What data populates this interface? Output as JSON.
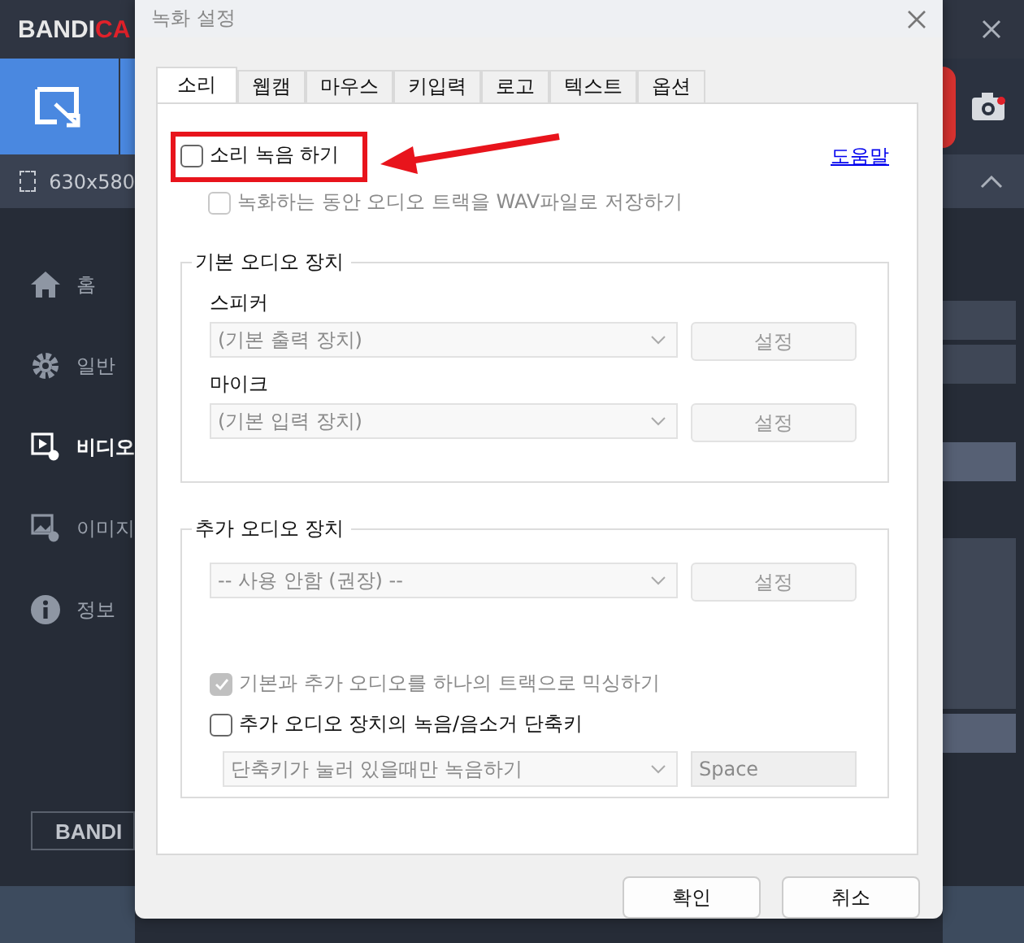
{
  "app": {
    "logo": [
      {
        "text": "BANDI",
        "kind": "plain"
      },
      {
        "text": "CA",
        "kind": "accent"
      }
    ],
    "size_label": "630x580",
    "sidebar": [
      {
        "label": "홈",
        "kind": "home",
        "selected": false
      },
      {
        "label": "일반",
        "kind": "gear",
        "selected": false
      },
      {
        "label": "비디오",
        "kind": "video",
        "selected": true
      },
      {
        "label": "이미지",
        "kind": "image",
        "selected": false
      },
      {
        "label": "정보",
        "kind": "info",
        "selected": false
      }
    ],
    "footer_button": "BANDI"
  },
  "dialog": {
    "title": "녹화 설정",
    "tabs": [
      {
        "label": "소리",
        "selected": true
      },
      {
        "label": "웹캠",
        "selected": false
      },
      {
        "label": "마우스",
        "selected": false
      },
      {
        "label": "키입력",
        "selected": false
      },
      {
        "label": "로고",
        "selected": false
      },
      {
        "label": "텍스트",
        "selected": false
      },
      {
        "label": "옵션",
        "selected": false
      }
    ],
    "record_sound": {
      "label": "소리 녹음 하기",
      "checked": false,
      "disabled": false,
      "highlighted": true
    },
    "help_link": "도움말",
    "save_wav": {
      "label": "녹화하는 동안 오디오 트랙을 WAV파일로 저장하기",
      "checked": false,
      "disabled": true
    },
    "primary_group": {
      "title": "기본 오디오 장치",
      "devices": [
        {
          "label": "스피커",
          "value": "(기본 출력 장치)",
          "button": "설정"
        },
        {
          "label": "마이크",
          "value": "(기본 입력 장치)",
          "button": "설정"
        }
      ]
    },
    "extra_group": {
      "title": "추가 오디오 장치",
      "device": {
        "value": "-- 사용 안함 (권장) --",
        "button": "설정"
      },
      "options": [
        {
          "label": "기본과 추가 오디오를 하나의 트랙으로 믹싱하기",
          "checked": true,
          "disabled": true
        },
        {
          "label": "추가 오디오 장치의 녹음/음소거 단축키",
          "checked": false,
          "disabled": false
        }
      ],
      "hotkey_mode": "단축키가 눌러 있을때만 녹음하기",
      "hotkey": "Space"
    },
    "buttons": [
      "확인",
      "취소"
    ]
  }
}
